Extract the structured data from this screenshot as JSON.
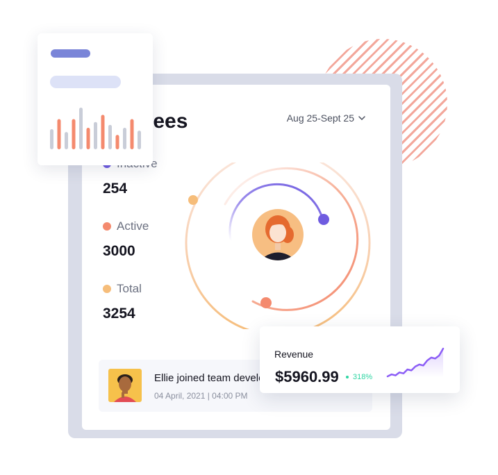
{
  "employees_card": {
    "title": "Employees",
    "date_range": "Aug 25-Sept 25",
    "stats": [
      {
        "label": "Inactive",
        "value": "254",
        "color": "#6f5ce0"
      },
      {
        "label": "Active",
        "value": "3000",
        "color": "#f48a6e"
      },
      {
        "label": "Total",
        "value": "3254",
        "color": "#f6bd7a"
      }
    ]
  },
  "activity": {
    "message": "Ellie joined team developers",
    "timestamp": "04 April, 2021 | 04:00 PM"
  },
  "revenue": {
    "label": "Revenue",
    "value": "$5960.99",
    "change": "318%",
    "change_color": "#2fd6a3",
    "line_color": "#8b5cf6"
  },
  "mini_chart": {
    "bars": [
      {
        "value": 28,
        "color": "#c9cdd8"
      },
      {
        "value": 42,
        "color": "#f48a6e"
      },
      {
        "value": 24,
        "color": "#c9cdd8"
      },
      {
        "value": 42,
        "color": "#f48a6e"
      },
      {
        "value": 58,
        "color": "#c9cdd8"
      },
      {
        "value": 30,
        "color": "#f48a6e"
      },
      {
        "value": 38,
        "color": "#c9cdd8"
      },
      {
        "value": 48,
        "color": "#f48a6e"
      },
      {
        "value": 34,
        "color": "#c9cdd8"
      },
      {
        "value": 20,
        "color": "#f48a6e"
      },
      {
        "value": 30,
        "color": "#c9cdd8"
      },
      {
        "value": 42,
        "color": "#f48a6e"
      },
      {
        "value": 26,
        "color": "#c9cdd8"
      }
    ]
  },
  "sparkline": {
    "values": [
      2,
      4,
      3,
      6,
      5,
      9,
      8,
      12,
      14,
      13,
      18,
      21,
      20,
      23,
      30
    ]
  },
  "icons": {
    "chevron": "chevron-down-icon",
    "avatar_main": "user-avatar-icon",
    "avatar_activity": "user-avatar-icon"
  }
}
